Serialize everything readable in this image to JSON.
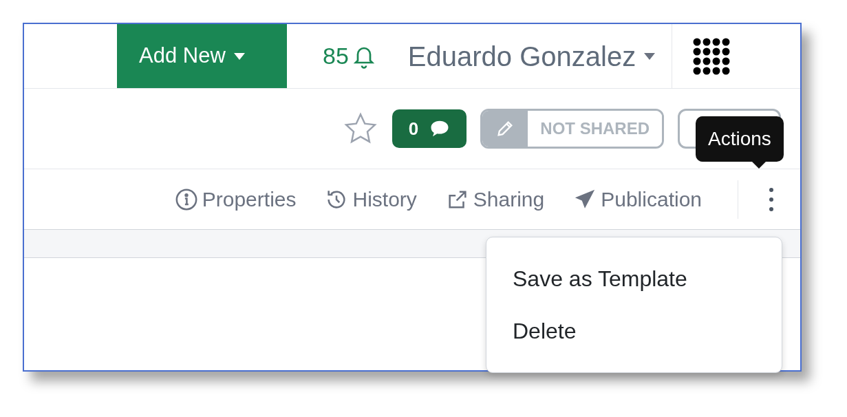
{
  "header": {
    "add_button": "Add New",
    "notification_count": "85",
    "user_name": "Eduardo Gonzalez"
  },
  "toolbar": {
    "favorite": false,
    "comments_count": "0",
    "sharing_status": "NOT SHARED"
  },
  "tooltip": "Actions",
  "tabs": [
    {
      "label": "Properties",
      "kind": "info"
    },
    {
      "label": "History",
      "kind": "history"
    },
    {
      "label": "Sharing",
      "kind": "share"
    },
    {
      "label": "Publication",
      "kind": "send"
    }
  ],
  "actions_menu": {
    "expanded": true,
    "items": [
      "Save as Template",
      "Delete"
    ]
  }
}
